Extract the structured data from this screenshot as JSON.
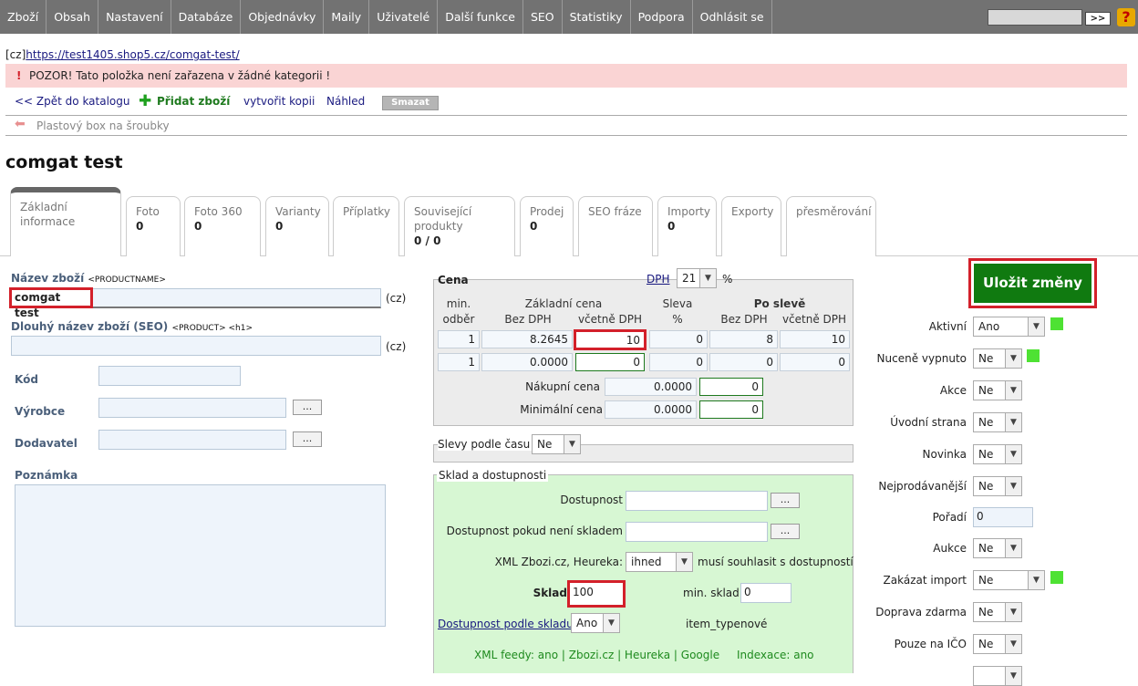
{
  "menu": [
    "Zboží",
    "Obsah",
    "Nastavení",
    "Databáze",
    "Objednávky",
    "Maily",
    "Uživatelé",
    "Další funkce",
    "SEO",
    "Statistiky",
    "Podpora",
    "Odhlásit se"
  ],
  "search_go": ">>",
  "help_icon": "?",
  "url_prefix": "[cz]",
  "url": "https://test1405.shop5.cz/comgat-test/",
  "warning": "POZOR! Tato položka není zařazena v žádné kategorii !",
  "warning_mark": "!",
  "actions": {
    "back": "<< Zpět do katalogu",
    "add": "Přidat zboží",
    "copy": "vytvořit kopii",
    "preview": "Náhled",
    "delete": "Smazat"
  },
  "breadcrumb": "Plastový box na šroubky",
  "page_title": "comgat test",
  "tabs": [
    {
      "label": "Základní informace",
      "count": ""
    },
    {
      "label": "Foto",
      "count": "0"
    },
    {
      "label": "Foto 360",
      "count": "0"
    },
    {
      "label": "Varianty",
      "count": "0"
    },
    {
      "label": "Příplatky",
      "count": ""
    },
    {
      "label": "Související produkty",
      "count": "0 / 0"
    },
    {
      "label": "Prodej",
      "count": "0"
    },
    {
      "label": "SEO fráze",
      "count": ""
    },
    {
      "label": "Importy",
      "count": "0"
    },
    {
      "label": "Exporty",
      "count": ""
    },
    {
      "label": "přesměrování",
      "count": ""
    }
  ],
  "left": {
    "name_label": "Název zboží",
    "name_tag": "<PRODUCTNAME>",
    "name_value": "comgat test",
    "lang": "(cz)",
    "long_label": "Dlouhý název zboží (SEO)",
    "long_tag": "<PRODUCT> <h1>",
    "long_value": "",
    "code_label": "Kód",
    "maker_label": "Výrobce",
    "supplier_label": "Dodavatel",
    "note_label": "Poznámka",
    "dots": "..."
  },
  "price": {
    "title": "Cena",
    "vat_link": "DPH",
    "vat_value": "21",
    "percent": "%",
    "h_min1": "min.",
    "h_min2": "odběr",
    "h_base": "Základní cena",
    "h_base_ex": "Bez DPH",
    "h_base_inc": "včetně DPH",
    "h_disc": "Sleva",
    "h_disc_pct": "%",
    "h_after": "Po slevě",
    "h_after_ex": "Bez DPH",
    "h_after_inc": "včetně DPH",
    "rows": [
      {
        "min": "1",
        "ex": "8.2645",
        "inc": "10",
        "disc": "0",
        "aex": "8",
        "ainc": "10"
      },
      {
        "min": "1",
        "ex": "0.0000",
        "inc": "0",
        "disc": "0",
        "aex": "0",
        "ainc": "0"
      }
    ],
    "purchase_label": "Nákupní cena",
    "purchase_ex": "0.0000",
    "purchase_inc": "0",
    "minimum_label": "Minimální cena",
    "minimum_ex": "0.0000",
    "minimum_inc": "0"
  },
  "time_disc": {
    "label": "Slevy podle času",
    "value": "Ne"
  },
  "stock": {
    "title": "Sklad a dostupnosti",
    "avail_label": "Dostupnost",
    "avail_out_label": "Dostupnost pokud není skladem",
    "xml_label": "XML Zbozi.cz, Heureka:",
    "xml_value": "ihned",
    "xml_note": "musí souhlasit s dostupností",
    "stock_label": "Sklad",
    "stock_value": "100",
    "min_label": "min. sklad",
    "min_value": "0",
    "by_stock_link": "Dostupnost podle skladu",
    "by_stock_value": "Ano",
    "item_type_label": "item_type",
    "item_type_value": "nové",
    "feeds": "XML feedy: ano | Zbozi.cz | Heureka | Google",
    "index": "Indexace: ano",
    "dots": "..."
  },
  "right": {
    "save": "Uložit změny",
    "fields": [
      {
        "label": "Aktivní",
        "value": "Ano",
        "indicator": true
      },
      {
        "label": "Nuceně vypnuto",
        "value": "Ne",
        "indicator": true
      },
      {
        "label": "Akce",
        "value": "Ne",
        "indicator": false
      },
      {
        "label": "Úvodní strana",
        "value": "Ne",
        "indicator": false
      },
      {
        "label": "Novinka",
        "value": "Ne",
        "indicator": false
      },
      {
        "label": "Nejprodávanější",
        "value": "Ne",
        "indicator": false
      },
      {
        "label": "Pořadí",
        "value": "0",
        "indicator": false
      },
      {
        "label": "Aukce",
        "value": "Ne",
        "indicator": false
      },
      {
        "label": "Zakázat import",
        "value": "Ne",
        "indicator": true
      },
      {
        "label": "Doprava zdarma",
        "value": "Ne",
        "indicator": false
      },
      {
        "label": "Pouze na IČO",
        "value": "Ne",
        "indicator": false
      }
    ]
  },
  "colors": {
    "topbar": "#727272",
    "warning_bg": "#fad4d4",
    "stock_bg": "#d7f7d3",
    "save_bg": "#107a10",
    "highlight": "#d3202a"
  }
}
